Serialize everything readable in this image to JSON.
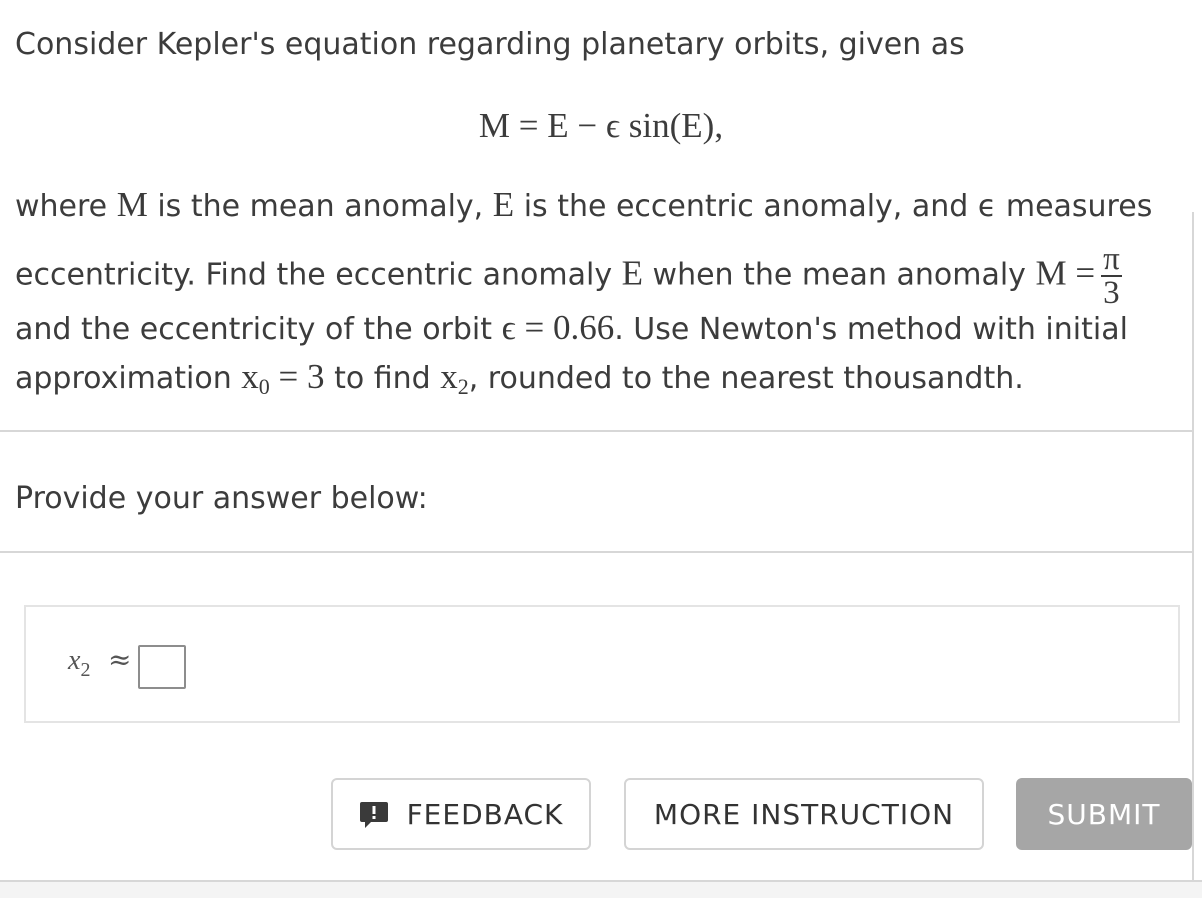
{
  "question": {
    "intro": "Consider Kepler's equation regarding planetary orbits, given as",
    "equation": "M = E − ϵ sin(E),",
    "p1_where": "where ",
    "p1_M": "M",
    "p1_t1": " is the mean anomaly, ",
    "p1_E": "E",
    "p1_t2": " is the eccentric anomaly, and ",
    "p1_eps": "ϵ",
    "p1_t3": " measures",
    "p2_t1": "eccentricity. Find the eccentric anomaly ",
    "p2_E": "E",
    "p2_t2": " when the mean anomaly ",
    "p2_Meq": "M =",
    "frac_num": "π",
    "frac_den": "3",
    "p3_t1": "and the eccentricity of the orbit ",
    "p3_eq": "ϵ = 0.66",
    "p3_t2": ". Use Newton's method with initial",
    "p4_t1": "approximation ",
    "p4_x": "x",
    "p4_sub0": "0",
    "p4_eq": " = 3",
    "p4_t2": " to find ",
    "p4_x2": "x",
    "p4_sub2": "2",
    "p4_t3": ", rounded to the nearest thousandth."
  },
  "answer_section": {
    "prompt": "Provide your answer below:",
    "label_var": "x",
    "label_sub": "2",
    "approx_symbol": "≈",
    "input_value": ""
  },
  "buttons": {
    "feedback": "FEEDBACK",
    "more_instruction": "MORE INSTRUCTION",
    "submit": "SUBMIT"
  },
  "icons": {
    "feedback": "feedback-speech-bubble-icon"
  }
}
